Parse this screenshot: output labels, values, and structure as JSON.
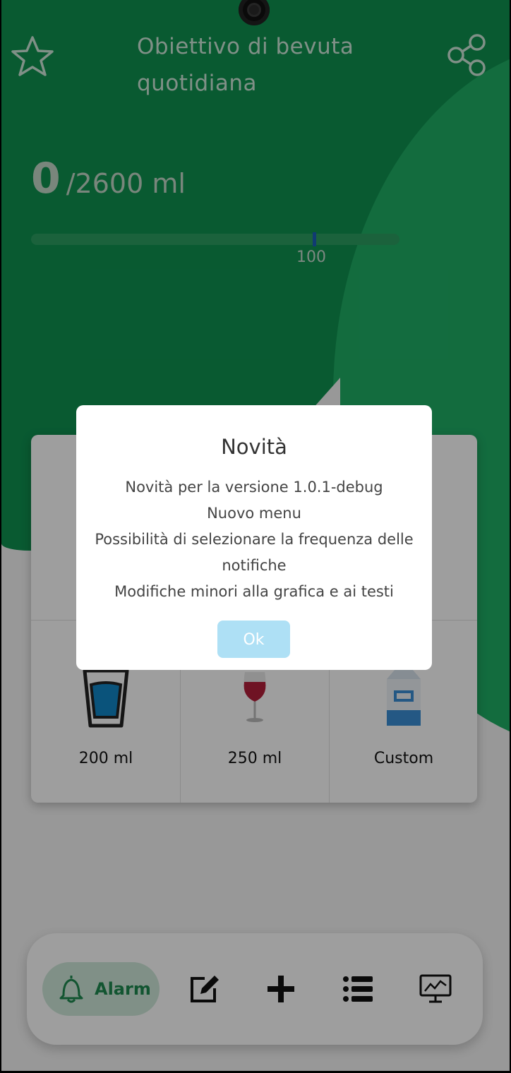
{
  "header": {
    "title": "Obiettivo di bevuta quotidiana",
    "current_amount": "0",
    "goal_text": "/2600 ml",
    "progress_label": "100"
  },
  "drinks": [
    {
      "label": "200 ml",
      "icon": "water-glass-icon"
    },
    {
      "label": "250 ml",
      "icon": "wine-glass-icon"
    },
    {
      "label": "Custom",
      "icon": "milk-carton-icon"
    }
  ],
  "nav": {
    "alarm_label": "Alarm",
    "items": [
      "bell-icon",
      "edit-icon",
      "plus-icon",
      "list-icon",
      "chart-monitor-icon"
    ]
  },
  "dialog": {
    "title": "Novità",
    "lines": [
      "Novità per la versione 1.0.1-debug",
      "Nuovo menu",
      "Possibilità di selezionare la frequenza delle notifiche",
      "Modifiche minori alla grafica e ai testi"
    ],
    "ok_label": "Ok"
  },
  "colors": {
    "primary_green": "#0f9150",
    "light_green": "#1fae65",
    "ok_button": "#aee0f5"
  }
}
